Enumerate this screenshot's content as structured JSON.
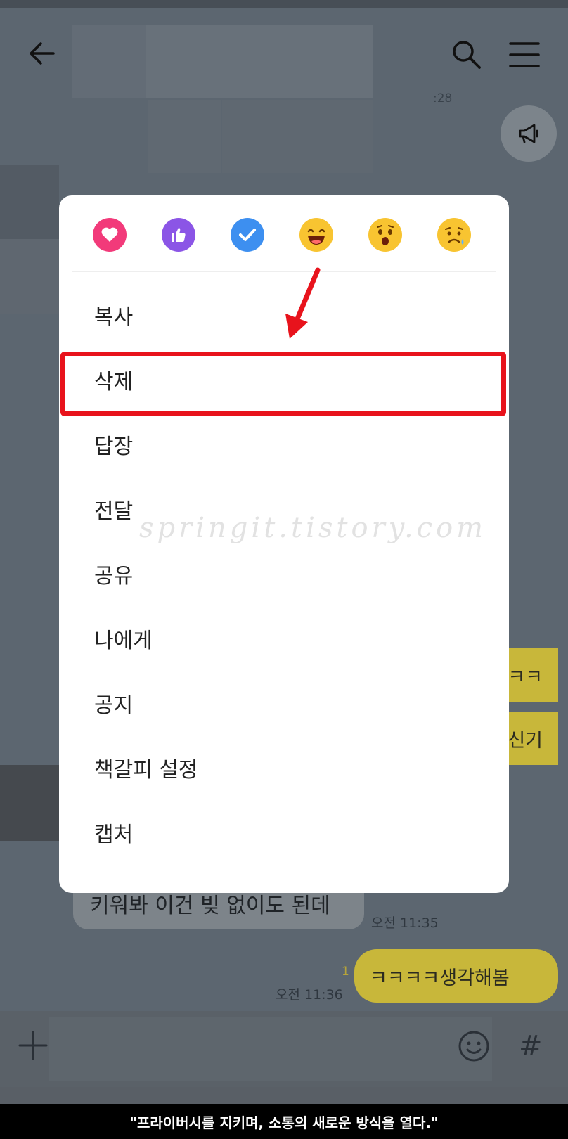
{
  "header": {
    "back_icon": "arrow-left-icon",
    "search_icon": "search-icon",
    "menu_icon": "hamburger-menu-icon",
    "notice_icon": "megaphone-icon",
    "partial_time": ":28"
  },
  "context_menu": {
    "reactions": [
      {
        "name": "heart-icon",
        "color": "#f23a7a"
      },
      {
        "name": "thumbs-up-icon",
        "color": "#8b55e6"
      },
      {
        "name": "check-icon",
        "color": "#3d8ff0"
      },
      {
        "name": "laughing-face-icon",
        "color": "#f8c431"
      },
      {
        "name": "surprised-face-icon",
        "color": "#f8c431"
      },
      {
        "name": "sad-face-icon",
        "color": "#f8c431"
      }
    ],
    "items": [
      {
        "label": "복사"
      },
      {
        "label": "삭제"
      },
      {
        "label": "답장"
      },
      {
        "label": "전달"
      },
      {
        "label": "공유"
      },
      {
        "label": "나에게"
      },
      {
        "label": "공지"
      },
      {
        "label": "책갈피 설정"
      },
      {
        "label": "캡처"
      }
    ],
    "highlighted_item": "삭제",
    "highlight_color": "#e8131c"
  },
  "watermark": "springit.tistory.com",
  "chat": {
    "partial_message_1": "ㅋㅋ",
    "partial_message_2": "신기",
    "received_message": "키워봐 이건 빚 없이도 된데",
    "received_time": "오전 11:35",
    "sent_message": "ㅋㅋㅋㅋ생각해봄",
    "sent_time": "오전 11:36",
    "sent_read_count": "1"
  },
  "input_bar": {
    "plus_icon": "plus-icon",
    "emoji_icon": "emoji-icon",
    "hashtag_label": "#"
  },
  "caption": "\"프라이버시를 지키며, 소통의 새로운 방식을 열다.\""
}
